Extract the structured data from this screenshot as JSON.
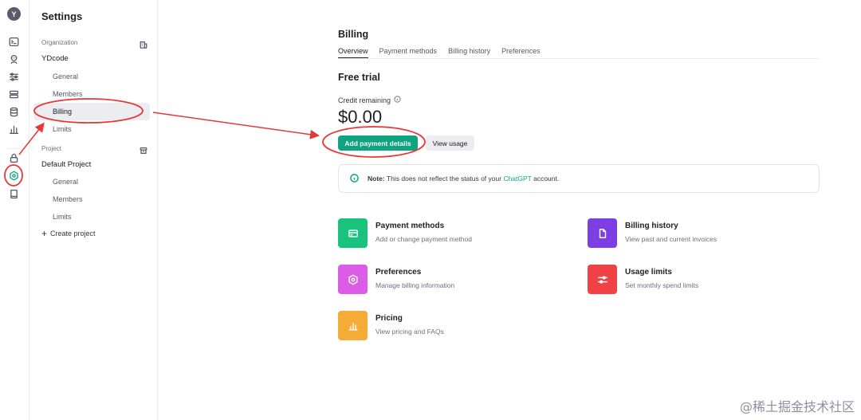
{
  "avatar": {
    "initial": "Y"
  },
  "rail": {
    "icons": [
      "terminal-icon",
      "assistant-icon",
      "sliders-icon",
      "storage-icon",
      "database-icon",
      "chart-icon",
      "lock-icon",
      "settings-icon",
      "book-icon"
    ],
    "active": "settings-icon"
  },
  "sidebar": {
    "title": "Settings",
    "organization": {
      "label": "Organization",
      "name": "YDcode",
      "items": [
        "General",
        "Members",
        "Billing",
        "Limits"
      ],
      "active": "Billing"
    },
    "project": {
      "label": "Project",
      "name": "Default Project",
      "items": [
        "General",
        "Members",
        "Limits"
      ]
    },
    "create_project": "Create project"
  },
  "main": {
    "title": "Billing",
    "tabs": [
      "Overview",
      "Payment methods",
      "Billing history",
      "Preferences"
    ],
    "active_tab": "Overview",
    "plan": "Free trial",
    "credit_label": "Credit remaining",
    "credit_amount": "$0.00",
    "primary_button": "Add payment details",
    "secondary_button": "View usage",
    "note": {
      "prefix": "Note:",
      "text": "This does not reflect the status of your",
      "link": "ChatGPT",
      "suffix": "account."
    },
    "cards": [
      {
        "title": "Payment methods",
        "desc": "Add or change payment method",
        "color": "#19c37d",
        "icon": "credit-card-icon"
      },
      {
        "title": "Billing history",
        "desc": "View past and current invoices",
        "color": "#7b3fe4",
        "icon": "document-icon"
      },
      {
        "title": "Preferences",
        "desc": "Manage billing information",
        "color": "#dd5ce5",
        "icon": "hex-settings-icon"
      },
      {
        "title": "Usage limits",
        "desc": "Set monthly spend limits",
        "color": "#ef4146",
        "icon": "sliders-icon"
      },
      {
        "title": "Pricing",
        "desc": "View pricing and FAQs",
        "color": "#f4ac36",
        "icon": "bar-chart-icon"
      }
    ]
  },
  "accent_color": "#10a37f",
  "annotation_color": "#e53935",
  "watermark": "@稀土掘金技术社区"
}
